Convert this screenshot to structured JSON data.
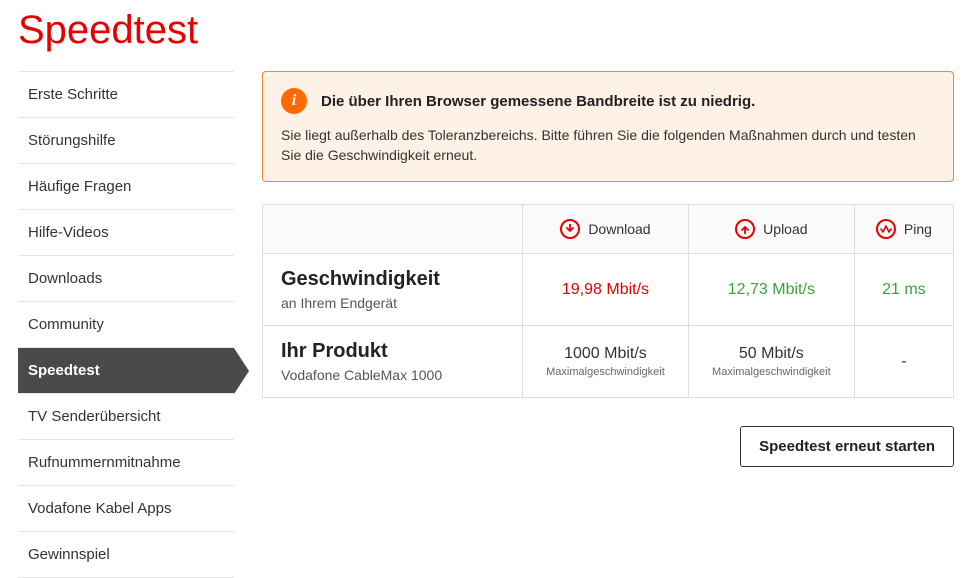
{
  "page_title": "Speedtest",
  "sidebar": {
    "items": [
      {
        "label": "Erste Schritte",
        "active": false
      },
      {
        "label": "Störungshilfe",
        "active": false
      },
      {
        "label": "Häufige Fragen",
        "active": false
      },
      {
        "label": "Hilfe-Videos",
        "active": false
      },
      {
        "label": "Downloads",
        "active": false
      },
      {
        "label": "Community",
        "active": false
      },
      {
        "label": "Speedtest",
        "active": true
      },
      {
        "label": "TV Senderübersicht",
        "active": false
      },
      {
        "label": "Rufnummernmitnahme",
        "active": false
      },
      {
        "label": "Vodafone Kabel Apps",
        "active": false
      },
      {
        "label": "Gewinnspiel",
        "active": false
      }
    ]
  },
  "alert": {
    "title": "Die über Ihren Browser gemessene Bandbreite ist zu niedrig.",
    "body": "Sie liegt außerhalb des Toleranzbereichs. Bitte führen Sie die folgenden Maßnahmen durch und testen Sie die Geschwindigkeit erneut."
  },
  "columns": {
    "download": "Download",
    "upload": "Upload",
    "ping": "Ping"
  },
  "rows": {
    "measured": {
      "title": "Geschwindigkeit",
      "sub": "an Ihrem Endgerät",
      "download": "19,98 Mbit/s",
      "upload": "12,73 Mbit/s",
      "ping": "21 ms"
    },
    "product": {
      "title": "Ihr Produkt",
      "sub": "Vodafone CableMax 1000",
      "download": "1000 Mbit/s",
      "download_sub": "Maximalgeschwindigkeit",
      "upload": "50 Mbit/s",
      "upload_sub": "Maximalgeschwindigkeit",
      "ping": "-"
    }
  },
  "actions": {
    "restart": "Speedtest erneut starten"
  }
}
